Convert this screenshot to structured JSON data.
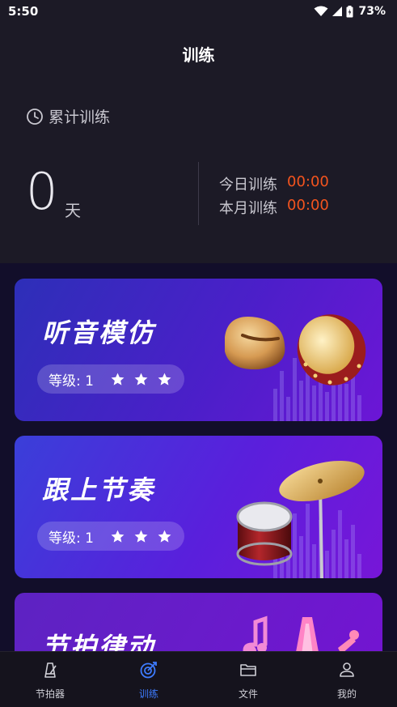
{
  "status_bar": {
    "time": "5:50",
    "battery": "73%"
  },
  "header": {
    "title": "训练",
    "total_label": "累计训练",
    "days_value": "0",
    "days_unit": "天",
    "today_label": "今日训练",
    "today_value": "00:00",
    "month_label": "本月训练",
    "month_value": "00:00"
  },
  "cards": [
    {
      "title": "听音模仿",
      "level_label": "等级: 1",
      "stars": 3
    },
    {
      "title": "跟上节奏",
      "level_label": "等级: 1",
      "stars": 3
    },
    {
      "title": "节拍律动"
    }
  ],
  "tabbar": {
    "items": [
      {
        "label": "节拍器",
        "icon": "metronome-icon"
      },
      {
        "label": "训练",
        "icon": "target-icon",
        "active": true
      },
      {
        "label": "文件",
        "icon": "folder-icon"
      },
      {
        "label": "我的",
        "icon": "user-icon"
      }
    ]
  },
  "colors": {
    "accent": "#3e7cff",
    "time_value": "#f4541e",
    "background": "#17141f"
  }
}
